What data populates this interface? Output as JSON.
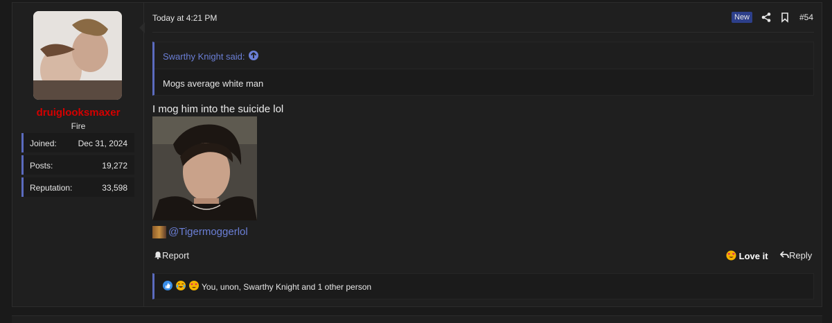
{
  "user": {
    "username": "druiglooksmaxer",
    "title": "Fire",
    "stats": [
      {
        "label": "Joined:",
        "value": "Dec 31, 2024"
      },
      {
        "label": "Posts:",
        "value": "19,272"
      },
      {
        "label": "Reputation:",
        "value": "33,598"
      }
    ]
  },
  "post": {
    "time": "Today at 4:21 PM",
    "badge": "New",
    "number": "#54",
    "quote": {
      "author": "Swarthy Knight said:",
      "text": "Mogs average white man"
    },
    "message": "I mog him into the suicide lol",
    "mention": "@Tigermoggerlol"
  },
  "actions": {
    "report": "Report",
    "love": "Love it",
    "reply": "Reply"
  },
  "reactions": {
    "icons": [
      "thumbs-up-icon",
      "crying-laughing-icon",
      "heart-eyes-icon"
    ],
    "text": "You, unon, Swarthy Knight and 1 other person"
  },
  "colors": {
    "username": "#d40000",
    "accent": "#5b6bbf",
    "link": "#6b7fd6",
    "badge": "#2d3f8a",
    "background": "#1f1f1f"
  }
}
